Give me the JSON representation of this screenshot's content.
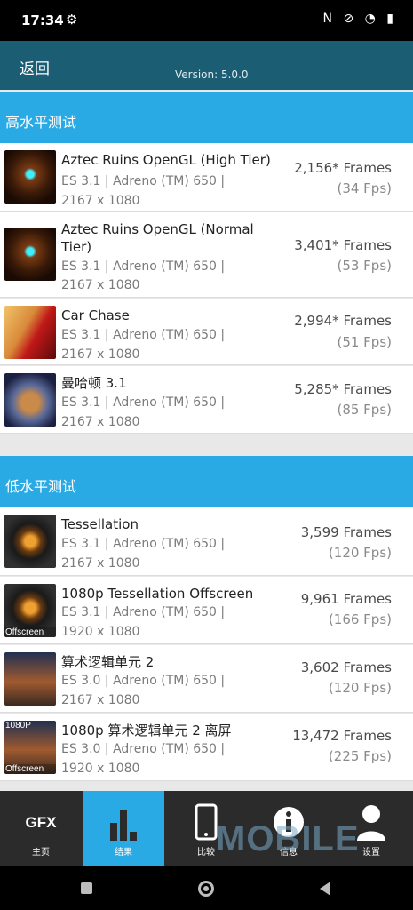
{
  "status": {
    "time": "17:34",
    "right": "N ⊘ ◔ ▮"
  },
  "header": {
    "back": "返回",
    "version": "Version: 5.0.0"
  },
  "sections": [
    {
      "title": "高水平测试"
    },
    {
      "title": "低水平测试"
    }
  ],
  "high": [
    {
      "title": "Aztec Ruins OpenGL (High Tier)",
      "meta1": "ES 3.1 | Adreno (TM) 650 |",
      "meta2": "2167 x 1080",
      "frames": "2,156* Frames",
      "fps": "(34 Fps)"
    },
    {
      "title": "Aztec Ruins OpenGL (Normal Tier)",
      "meta1": "ES 3.1 | Adreno (TM) 650 |",
      "meta2": "2167 x 1080",
      "frames": "3,401* Frames",
      "fps": "(53 Fps)"
    },
    {
      "title": "Car Chase",
      "meta1": "ES 3.1 | Adreno (TM) 650 |",
      "meta2": "2167 x 1080",
      "frames": "2,994* Frames",
      "fps": "(51 Fps)"
    },
    {
      "title": "曼哈顿 3.1",
      "meta1": "ES 3.1 | Adreno (TM) 650 |",
      "meta2": "2167 x 1080",
      "frames": "5,285* Frames",
      "fps": "(85 Fps)"
    }
  ],
  "low": [
    {
      "title": "Tessellation",
      "meta1": "ES 3.1 | Adreno (TM) 650 |",
      "meta2": "2167 x 1080",
      "frames": "3,599 Frames",
      "fps": "(120 Fps)"
    },
    {
      "title": "1080p Tessellation Offscreen",
      "meta1": "ES 3.1 | Adreno (TM) 650 |",
      "meta2": "1920 x 1080",
      "frames": "9,961 Frames",
      "fps": "(166 Fps)",
      "badge": "Offscreen"
    },
    {
      "title": "算术逻辑单元 2",
      "meta1": "ES 3.0 | Adreno (TM) 650 |",
      "meta2": "2167 x 1080",
      "frames": "3,602 Frames",
      "fps": "(120 Fps)"
    },
    {
      "title": "1080p 算术逻辑单元 2 离屏",
      "meta1": "ES 3.0 | Adreno (TM) 650 |",
      "meta2": "1920 x 1080",
      "frames": "13,472 Frames",
      "fps": "(225 Fps)",
      "badge_top": "1080P",
      "badge": "Offscreen"
    }
  ],
  "tabs": [
    {
      "label": "主页",
      "icon_text": "GFX"
    },
    {
      "label": "结果"
    },
    {
      "label": "比较"
    },
    {
      "label": "信息"
    },
    {
      "label": "设置"
    }
  ],
  "watermark": "MOBILE"
}
